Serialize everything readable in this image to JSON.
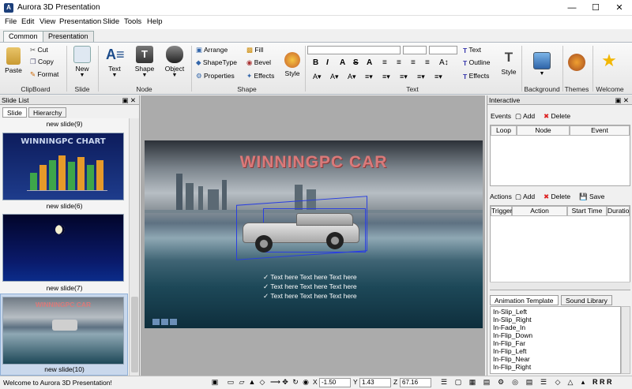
{
  "window": {
    "title": "Aurora 3D Presentation"
  },
  "menu": [
    "File",
    "Edit",
    "View",
    "Presentation",
    "Slide",
    "Tools",
    "Help"
  ],
  "ribbon_tabs": [
    "Common",
    "Presentation"
  ],
  "ribbon": {
    "paste": "Paste",
    "cut": "Cut",
    "copy": "Copy",
    "format": "Format",
    "clipboard_group": "ClipBoard",
    "new": "New",
    "slide_group": "Slide",
    "text": "Text",
    "shape": "Shape",
    "object": "Object",
    "node_group": "Node",
    "arrange": "Arrange",
    "shapetype": "ShapeType",
    "properties": "Properties",
    "fill": "Fill",
    "bevel": "Bevel",
    "effects": "Effects",
    "style": "Style",
    "shape_group": "Shape",
    "fmt_buttons": [
      "B",
      "I",
      "A",
      "S",
      "A"
    ],
    "text_btn": "Text",
    "outline_btn": "Outline",
    "effects_btn": "Effects",
    "style2": "Style",
    "text_group": "Text",
    "background": "Background",
    "themes": "Themes",
    "welcome": "Welcome"
  },
  "slide_panel": {
    "title": "Slide List",
    "tabs": [
      "Slide",
      "Hierarchy"
    ],
    "labels": [
      "new slide(9)",
      "new slide(6)",
      "new slide(7)",
      "new slide(10)"
    ],
    "thumb1_title": "WINNINGPC CHART",
    "thumb4_title": "WINNINGPC CAR"
  },
  "canvas": {
    "slide_title": "WINNINGPC CAR",
    "bullets": [
      "Text here Text here Text here",
      "Text here Text here Text here",
      "Text here Text here Text here"
    ]
  },
  "interactive": {
    "title": "Interactive",
    "events_label": "Events",
    "add": "Add",
    "delete": "Delete",
    "event_cols": [
      "Loop",
      "Node",
      "Event"
    ],
    "actions_label": "Actions",
    "save": "Save",
    "action_cols": [
      "Trigger",
      "Action",
      "Start Time",
      "Duration"
    ],
    "sub_tabs": [
      "Animation Template",
      "Sound Library"
    ],
    "templates": [
      "In-Slip_Left",
      "In-Slip_Right",
      "In-Fade_In",
      "In-Flip_Down",
      "In-Flip_Far",
      "In-Flip_Left",
      "In-Flip_Near",
      "In-Flip_Right"
    ]
  },
  "status": {
    "message": "Welcome to Aurora 3D Presentation!",
    "x": "-1.50",
    "y": "1.43",
    "z": "67.16",
    "x_label": "X",
    "y_label": "Y",
    "z_label": "Z",
    "rrr": "R R R"
  },
  "colors": {
    "accent": "#1c3f7a",
    "title_red": "#d97a7a"
  }
}
